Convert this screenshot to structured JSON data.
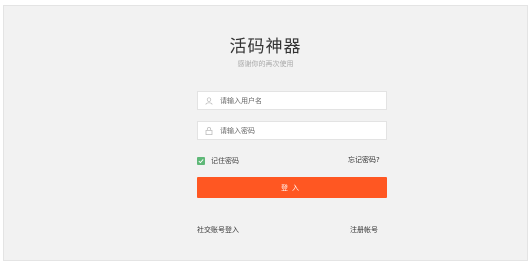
{
  "header": {
    "title": "活码神器",
    "subtitle": "感谢你的再次使用"
  },
  "form": {
    "username_placeholder": "请输入用户名",
    "password_placeholder": "请输入密码",
    "remember_label": "记住密码",
    "remember_checked": true,
    "forgot_label": "忘记密码?",
    "login_label": "登入"
  },
  "footer": {
    "social_label": "社交账号登入",
    "register_label": "注册帐号"
  },
  "colors": {
    "accent": "#ff5722",
    "checkbox": "#5fb878",
    "panel_bg": "#f2f2f2"
  },
  "icons": {
    "username": "user-icon",
    "password": "lock-icon",
    "checkbox": "check-icon"
  }
}
